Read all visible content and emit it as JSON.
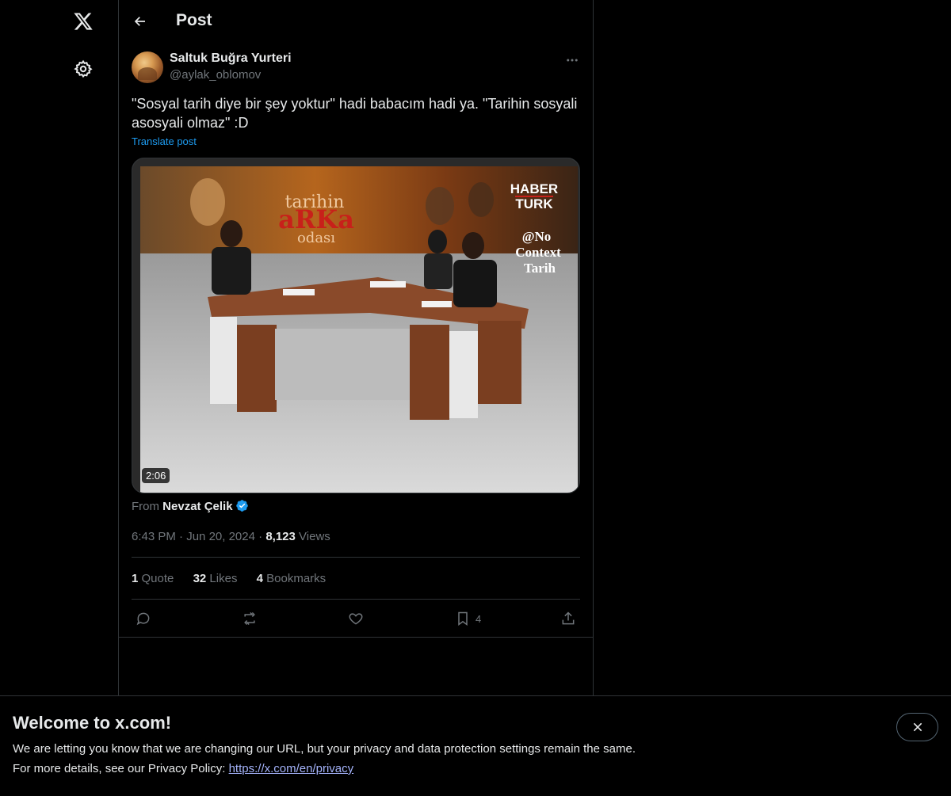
{
  "nav": {
    "logo_icon": "x-logo-icon",
    "settings_icon": "gear-icon"
  },
  "header": {
    "title": "Post"
  },
  "tweet": {
    "author_name": "Saltuk Buğra Yurteri",
    "author_handle": "@aylak_oblomov",
    "text": "\"Sosyal tarih diye bir şey yoktur\" hadi babacım hadi ya. \"Tarihin sosyali asosyali olmaz\" :D",
    "translate_label": "Translate post",
    "media": {
      "overlay_title_1": "tarihin",
      "overlay_title_2": "aRKa",
      "overlay_title_3": "odası",
      "channel_1": "HABER",
      "channel_2": "TURK",
      "watermark_1": "@No",
      "watermark_2": "Context",
      "watermark_3": "Tarih",
      "duration": "2:06"
    },
    "from_label": "From",
    "from_name": "Nevzat Çelik",
    "time": "6:43 PM",
    "date": "Jun 20, 2024",
    "dot": "·",
    "views_count": "8,123",
    "views_label": "Views",
    "quotes_count": "1",
    "quotes_label": "Quote",
    "likes_count": "32",
    "likes_label": "Likes",
    "bookmarks_count": "4",
    "bookmarks_label": "Bookmarks",
    "bookmark_action_count": "4"
  },
  "banner": {
    "title": "Welcome to x.com!",
    "line1": "We are letting you know that we are changing our URL, but your privacy and data protection settings remain the same.",
    "line2_prefix": "For more details, see our Privacy Policy: ",
    "link": "https://x.com/en/privacy"
  },
  "colors": {
    "accent": "#1d9bf0",
    "text": "#e7e9ea",
    "muted": "#71767b",
    "border": "#2f3336",
    "background": "#000000"
  }
}
